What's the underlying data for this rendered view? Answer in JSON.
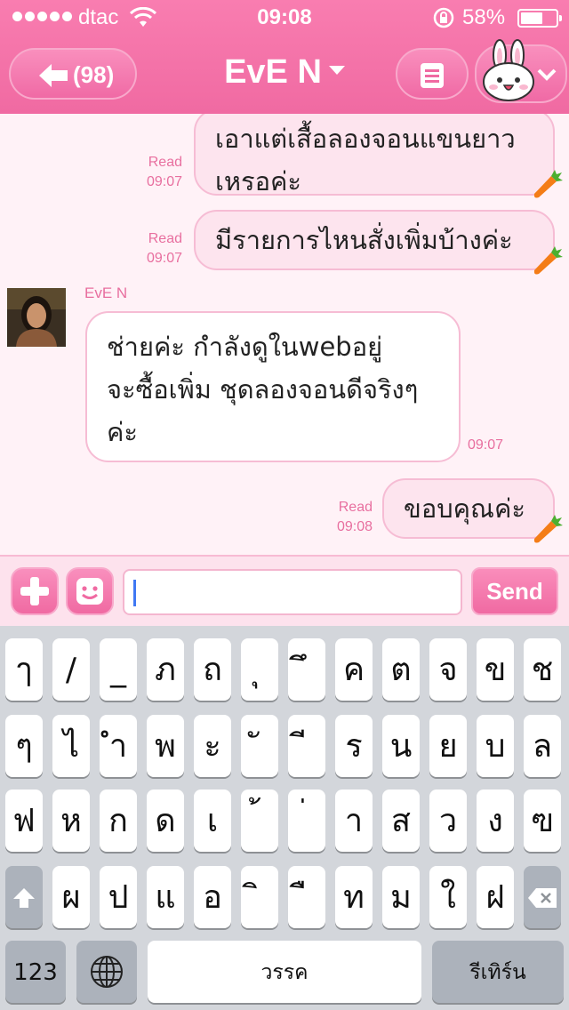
{
  "status_bar": {
    "carrier": "dtac",
    "time": "09:08",
    "battery": "58%"
  },
  "header": {
    "back_count": "(98)",
    "title": "EvE N"
  },
  "messages": [
    {
      "side": "out",
      "lines": [
        "เอาแต่เสื้อลองจอนแขนยาว",
        "เหรอค่ะ"
      ],
      "status": "Read",
      "time": "09:07"
    },
    {
      "side": "out",
      "lines": [
        "มีรายการไหนสั่งเพิ่มบ้างค่ะ"
      ],
      "status": "Read",
      "time": "09:07"
    },
    {
      "side": "in",
      "sender": "EvE N",
      "lines": [
        "ช่ายค่ะ กำลังดูในwebอยู่",
        "จะซื้อเพิ่ม ชุดลองจอนดีจริงๆ",
        "ค่ะ"
      ],
      "time": "09:07"
    },
    {
      "side": "out",
      "lines": [
        "ขอบคุณค่ะ"
      ],
      "status": "Read",
      "time": "09:08"
    }
  ],
  "input": {
    "value": "",
    "send_label": "Send"
  },
  "keyboard": {
    "row1": [
      "ๅ",
      "/",
      "_",
      "ภ",
      "ถ",
      "ุ",
      "ึ",
      "ค",
      "ต",
      "จ",
      "ข",
      "ช"
    ],
    "row2": [
      "ๆ",
      "ไ",
      "ำ",
      "พ",
      "ะ",
      "ั",
      "ี",
      "ร",
      "น",
      "ย",
      "บ",
      "ล"
    ],
    "row3": [
      "ฟ",
      "ห",
      "ก",
      "ด",
      "เ",
      "้",
      "่",
      "า",
      "ส",
      "ว",
      "ง",
      "ฃ"
    ],
    "row4": [
      "ผ",
      "ป",
      "แ",
      "อ",
      "ิ",
      "ื",
      "ท",
      "ม",
      "ใ",
      "ฝ"
    ],
    "numbers_label": "123",
    "space_label": "วรรค",
    "return_label": "รีเทิร์น"
  },
  "colors": {
    "accent": "#f06aa2",
    "header": "#f97db0",
    "chat_bg": "#fff2f7",
    "outgoing_bubble": "#fde4ee",
    "meta_text": "#e86f9f"
  }
}
